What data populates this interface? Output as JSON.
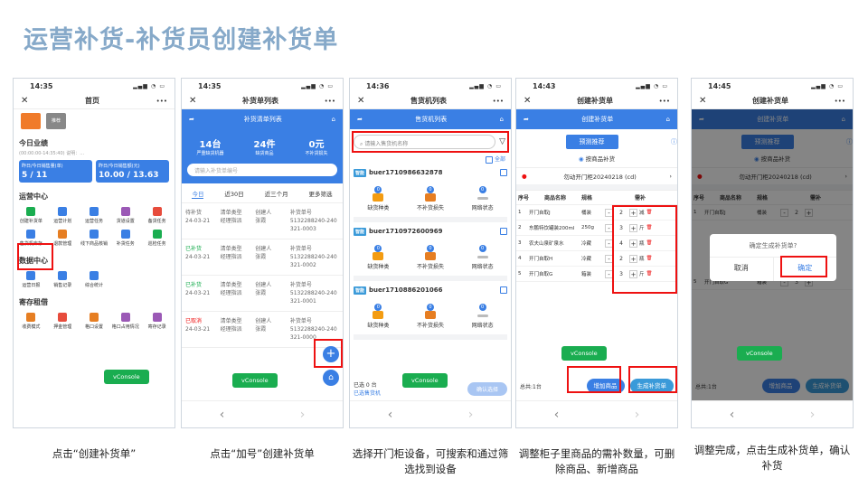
{
  "slide_title": "运营补货-补货员创建补货单",
  "captions": [
    "点击“创建补货单”",
    "点击“加号”创建补货单",
    "选择开门柜设备，可搜索和通过筛选找到设备",
    "调整柜子里商品的需补数量，可删除商品、新增商品",
    "调整完成，点击生成补货单，确认补货"
  ],
  "vconsole": "vConsole",
  "phone1": {
    "time": "14:35",
    "title": "首页",
    "top_label": "推荐",
    "perf_title": "今日业绩",
    "perf_sub": "(00:00:00-14:35:40)  说明：…",
    "card1_label": "昨日/今日销售量(单)",
    "card1_val": "5 / 11",
    "card2_label": "昨日/今日销售额(元)",
    "card2_val": "10.00 / 13.63",
    "ops_title": "运营中心",
    "ops": [
      "创建补货单",
      "运营计划",
      "运营任务",
      "货道设置",
      "备货任务",
      "售货机库存",
      "退款管理",
      "线下商品核销",
      "补货任务",
      "巡检任务"
    ],
    "data_title": "数据中心",
    "data_items": [
      "运营日报",
      "销售记录",
      "综合统计"
    ],
    "rent_title": "寄存租借",
    "rent_items": [
      "收费模式",
      "押金管理",
      "格口设置",
      "格口占用情况",
      "寄存记录"
    ]
  },
  "phone2": {
    "time": "14:35",
    "title": "补货单列表",
    "header": "补货清单列表",
    "stats": [
      {
        "v": "14台",
        "l": "严重缺货机器"
      },
      {
        "v": "24件",
        "l": "缺货商品"
      },
      {
        "v": "0元",
        "l": "不补货损失"
      }
    ],
    "search_placeholder": "请输入补货单编号",
    "tabs": [
      "今日",
      "近30日",
      "近三个月",
      "更多筛选"
    ],
    "orders": [
      {
        "status": "待补货",
        "date": "24-03-21",
        "type": "清单类型",
        "type_v": "经理指派",
        "creator": "创建人",
        "creator_v": "张霞",
        "no": "补货单号",
        "no_v": "5132288240-240321-0003"
      },
      {
        "status": "已补货",
        "date": "24-03-21",
        "type": "清单类型",
        "type_v": "经理指派",
        "creator": "创建人",
        "creator_v": "张霞",
        "no": "补货单号",
        "no_v": "5132288240-240321-0002"
      },
      {
        "status": "已补货",
        "date": "24-03-21",
        "type": "清单类型",
        "type_v": "经理指派",
        "creator": "创建人",
        "creator_v": "张霞",
        "no": "补货单号",
        "no_v": "5132288240-240321-0001"
      },
      {
        "status": "已取消",
        "date": "24-03-21",
        "type": "清单类型",
        "type_v": "经理指派",
        "creator": "创建人",
        "creator_v": "张霞",
        "no": "补货单号",
        "no_v": "5132288240-240321-0000"
      }
    ]
  },
  "phone3": {
    "time": "14:36",
    "title": "售货机列表",
    "header": "售货机列表",
    "search_placeholder": "请输入售货机名称",
    "select_all": "全部",
    "tag": "智能",
    "devices": [
      {
        "id": "buer1710986632878",
        "b1": "0",
        "b2": "0",
        "b3": "0"
      },
      {
        "id": "buer1710972600969",
        "b1": "0",
        "b2": "0",
        "b3": "0"
      },
      {
        "id": "buer1710886201066",
        "b1": "0",
        "b2": "0",
        "b3": "0"
      }
    ],
    "icon_labels": [
      "缺货种类",
      "不补货损失",
      "网络状态"
    ],
    "footer_selected": "已选 0 台",
    "footer_link": "已选售货机",
    "confirm": "确认选择"
  },
  "phone4": {
    "time": "14:43",
    "title": "创建补货单",
    "header": "创建补货单",
    "predict": "预测推荐",
    "by_goods": "按商品补货",
    "machine": "勿动开门柜20240218 (cd)",
    "cols": [
      "序号",
      "商品名称",
      "规格",
      "需补"
    ],
    "rows": [
      {
        "i": "1",
        "n": "开门自取J",
        "s": "桶装",
        "q": "2",
        "u": "减"
      },
      {
        "i": "2",
        "n": "东鹏特饮罐装200ml",
        "s": "250g",
        "q": "3",
        "u": "斤"
      },
      {
        "i": "3",
        "n": "农夫山泉矿泉水",
        "s": "冷藏",
        "q": "4",
        "u": "瓶"
      },
      {
        "i": "4",
        "n": "开门自取H",
        "s": "冷藏",
        "q": "2",
        "u": "瓶"
      },
      {
        "i": "5",
        "n": "开门自取G",
        "s": "箱装",
        "q": "3",
        "u": "斤"
      }
    ],
    "total": "总共:1台",
    "add_goods": "增加商品",
    "generate": "生成补货单"
  },
  "phone5": {
    "time": "14:45",
    "title": "创建补货单",
    "header": "创建补货单",
    "predict": "预测推荐",
    "by_goods": "按商品补货",
    "machine": "勿动开门柜20240218 (cd)",
    "cols": [
      "序号",
      "商品名称",
      "规格",
      "需补"
    ],
    "rows": [
      {
        "i": "1",
        "n": "开门自取J",
        "s": "桶装",
        "q": "2"
      },
      {
        "i": "5",
        "n": "开门自取G",
        "s": "箱装",
        "q": "3"
      }
    ],
    "dialog_title": "确定生成补货单?",
    "cancel": "取消",
    "confirm": "确定",
    "total": "总共:1台",
    "add_goods": "增加商品",
    "generate": "生成补货单"
  }
}
